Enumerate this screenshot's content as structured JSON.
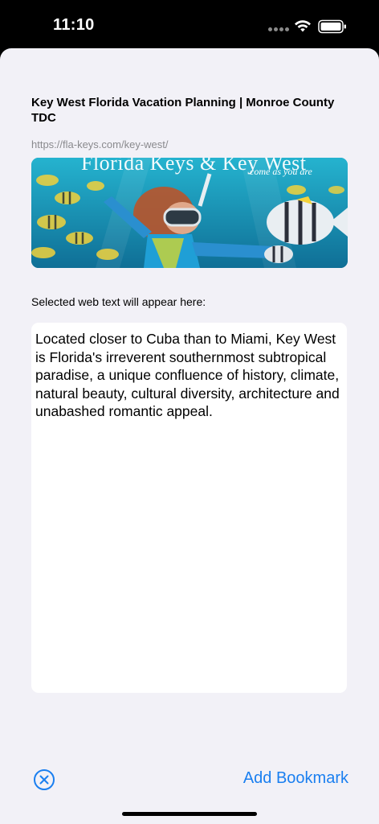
{
  "status_bar": {
    "time": "11:10",
    "icons": [
      "signal-dots-icon",
      "wifi-icon",
      "battery-icon"
    ]
  },
  "bookmark": {
    "title": "Key West Florida Vacation Planning | Monroe County TDC",
    "url": "https://fla-keys.com/key-west/",
    "image": {
      "headline": "Florida Keys & Key West",
      "tagline": "come as you are"
    }
  },
  "selection": {
    "label": "Selected web text will appear here:",
    "text": "Located closer to Cuba than to Miami, Key West is Florida's irreverent southernmost subtropical paradise, a unique confluence of history, climate, natural beauty, cultural diversity, architecture and unabashed romantic appeal."
  },
  "actions": {
    "cancel_icon": "close-circle-icon",
    "add_bookmark_label": "Add Bookmark"
  },
  "colors": {
    "accent": "#1a7ff0",
    "sheet_background": "#f2f1f7",
    "status_bar_background": "#000000"
  }
}
